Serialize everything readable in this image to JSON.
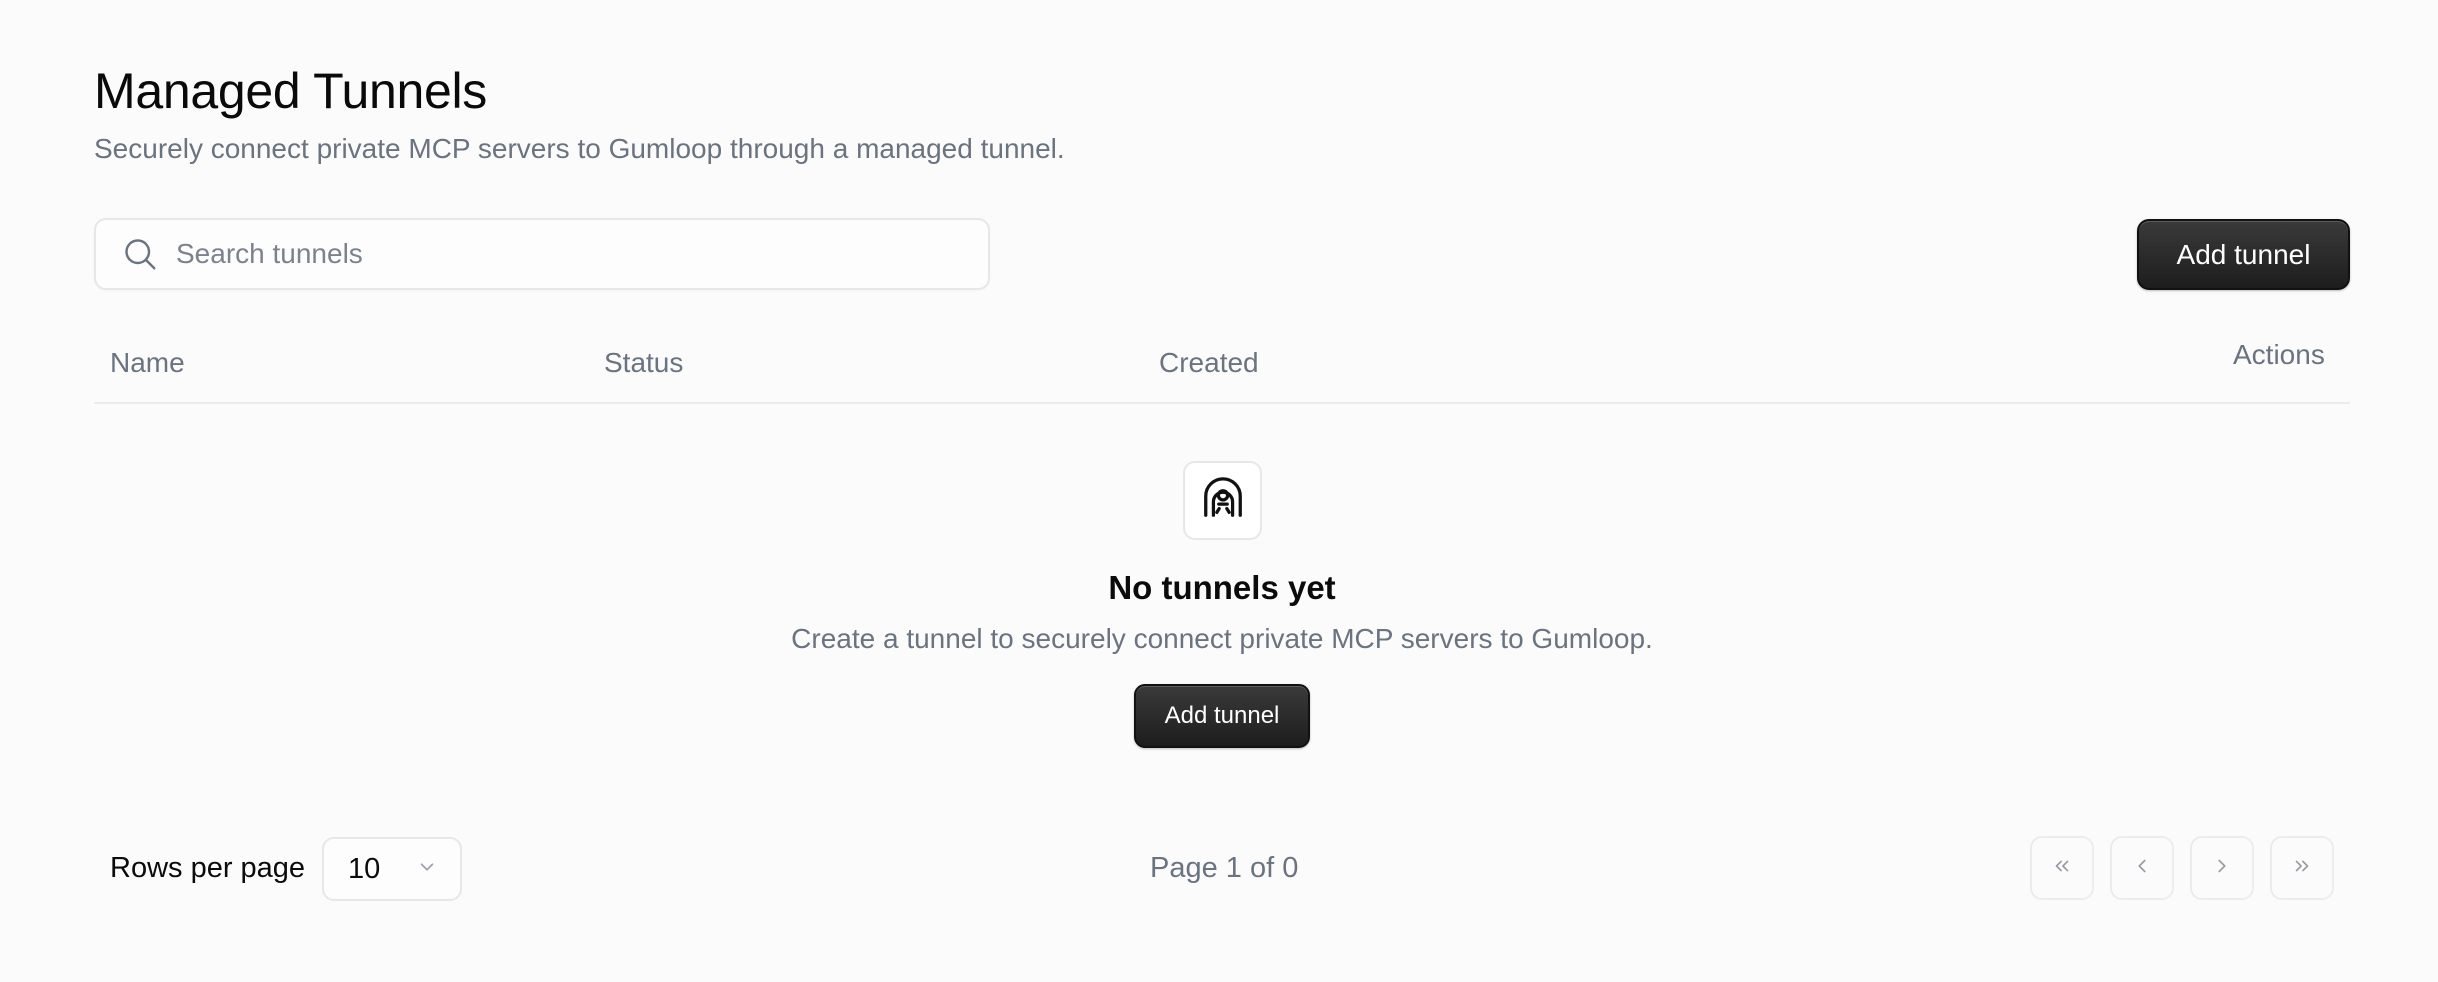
{
  "header": {
    "title": "Managed Tunnels",
    "subtitle": "Securely connect private MCP servers to Gumloop through a managed tunnel."
  },
  "toolbar": {
    "search_placeholder": "Search tunnels",
    "search_value": "",
    "add_label": "Add tunnel"
  },
  "table": {
    "columns": [
      "Name",
      "Status",
      "Created",
      "Actions"
    ],
    "rows": []
  },
  "empty_state": {
    "icon": "tunnel-icon",
    "title": "No tunnels yet",
    "description": "Create a tunnel to securely connect private MCP servers to Gumloop.",
    "add_label": "Add tunnel"
  },
  "pagination": {
    "rows_per_page_label": "Rows per page",
    "rows_per_page_value": "10",
    "page_info": "Page 1 of 0",
    "buttons": [
      "first-page",
      "previous-page",
      "next-page",
      "last-page"
    ]
  },
  "colors": {
    "background": "#fbfbfb",
    "primary_button": "#232324",
    "muted_text": "#6a7380",
    "border": "#e6e7ea"
  }
}
